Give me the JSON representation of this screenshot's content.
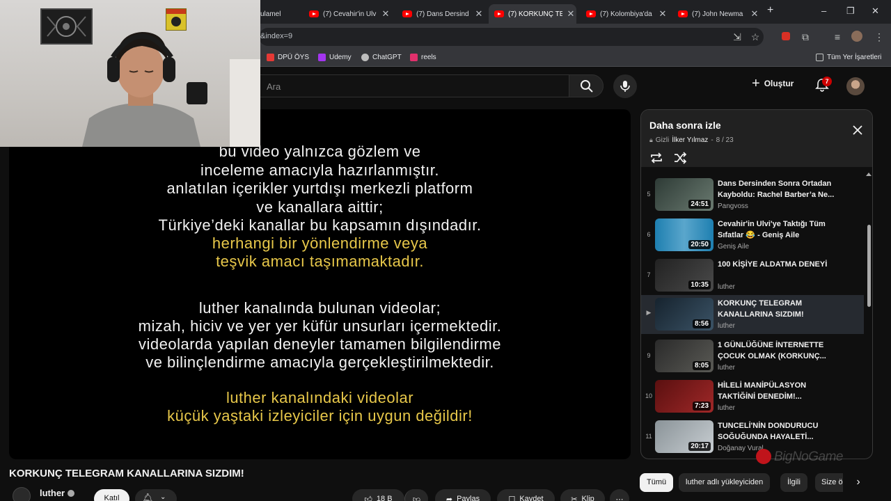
{
  "tabs": [
    {
      "label": "ulamel",
      "favicon": "none"
    },
    {
      "label": "(7) Cevahir'in Ulv",
      "favicon": "youtube-icon"
    },
    {
      "label": "(7) Dans Dersind",
      "favicon": "youtube-icon"
    },
    {
      "label": "(7) KORKUNÇ TE",
      "favicon": "youtube-icon",
      "active": true
    },
    {
      "label": "(7) Kolombiya'da",
      "favicon": "youtube-icon"
    },
    {
      "label": "(7) John Newma",
      "favicon": "youtube-icon"
    }
  ],
  "address": {
    "url_fragment": "&index=9"
  },
  "bookmarks": [
    {
      "label": "DPÜ ÖYS",
      "color": "#e53935"
    },
    {
      "label": "Udemy",
      "color": "#a435f0"
    },
    {
      "label": "ChatGPT",
      "color": "#bdbdbd"
    },
    {
      "label": "reels",
      "color": "#e1306c"
    }
  ],
  "bookmarks_folder": "Tüm Yer İşaretleri",
  "youtube": {
    "search_placeholder": "Ara",
    "create_label": "Oluştur",
    "notification_count": "7"
  },
  "video_text": {
    "white_lines_1": [
      "bu video yalnızca gözlem ve",
      "inceleme amacıyla hazırlanmıştır.",
      "anlatılan içerikler yurtdışı merkezli platform",
      "ve kanallara aittir;",
      "Türkiye’deki kanallar bu kapsamın dışındadır."
    ],
    "yellow_lines_1": [
      "herhangi bir yönlendirme veya",
      "teşvik amacı taşımamaktadır."
    ],
    "white_lines_2": [
      "luther kanalında bulunan videolar;",
      "mizah, hiciv ve yer yer küfür unsurları içermektedir.",
      "videolarda yapılan deneyler tamamen bilgilendirme",
      "ve bilinçlendirme amacıyla gerçekleştirilmektedir."
    ],
    "yellow_lines_2": [
      "luther kanalındaki videolar",
      "küçük yaştaki izleyiciler için uygun değildir!"
    ]
  },
  "video": {
    "title": "KORKUNÇ TELEGRAM KANALLARINA SIZDIM!",
    "channel": "luther",
    "join_label": "Katıl",
    "like_count": "18 B",
    "share_label": "Paylaş",
    "save_label": "Kaydet",
    "clip_label": "Klip"
  },
  "playlist": {
    "title": "Daha sonra izle",
    "privacy": "Gizli",
    "owner": "İlker Yılmaz",
    "position": "8 / 23",
    "items": [
      {
        "index": "5",
        "title": "Dans Dersinden Sonra Ortadan Kayboldu: Rachel Barber’a Ne...",
        "channel": "Pangvoss",
        "duration": "24:51",
        "thumb": "#3c4a44"
      },
      {
        "index": "6",
        "title": "Cevahir'in Ulvi'ye Taktığı Tüm Sıfatlar 😂 - Geniş Aile",
        "channel": "Geniş Aile",
        "duration": "20:50",
        "thumb": "#2a7fa6"
      },
      {
        "index": "7",
        "title": "100 KİŞİYE ALDATMA DENEYİ",
        "channel": "luther",
        "duration": "10:35",
        "thumb": "#2b2b2b"
      },
      {
        "index": "▶",
        "title": "KORKUNÇ TELEGRAM KANALLARINA SIZDIM!",
        "channel": "luther",
        "duration": "8:56",
        "thumb": "#1f2f3c",
        "active": true
      },
      {
        "index": "9",
        "title": "1 GÜNLÜĞÜNE İNTERNETTE ÇOCUK OLMAK (KORKUNÇ...",
        "channel": "luther",
        "duration": "8:05",
        "thumb": "#3a3a3a"
      },
      {
        "index": "10",
        "title": "HİLELİ MANİPÜLASYON TAKTİĞİNİ DENEDİM!...",
        "channel": "luther",
        "duration": "7:23",
        "thumb": "#7a1a1a"
      },
      {
        "index": "11",
        "title": "TUNCELİ'NİN DONDURUCU SOĞUĞUNDA HAYALETİ...",
        "channel": "Doğanay Vural",
        "duration": "20:17",
        "thumb": "#9aa3a8"
      }
    ]
  },
  "chips": [
    {
      "label": "Tümü",
      "selected": true
    },
    {
      "label": "luther adlı yükleyiciden"
    },
    {
      "label": "İlgili"
    },
    {
      "label": "Size ö"
    }
  ],
  "watermark": "BigNoGame"
}
